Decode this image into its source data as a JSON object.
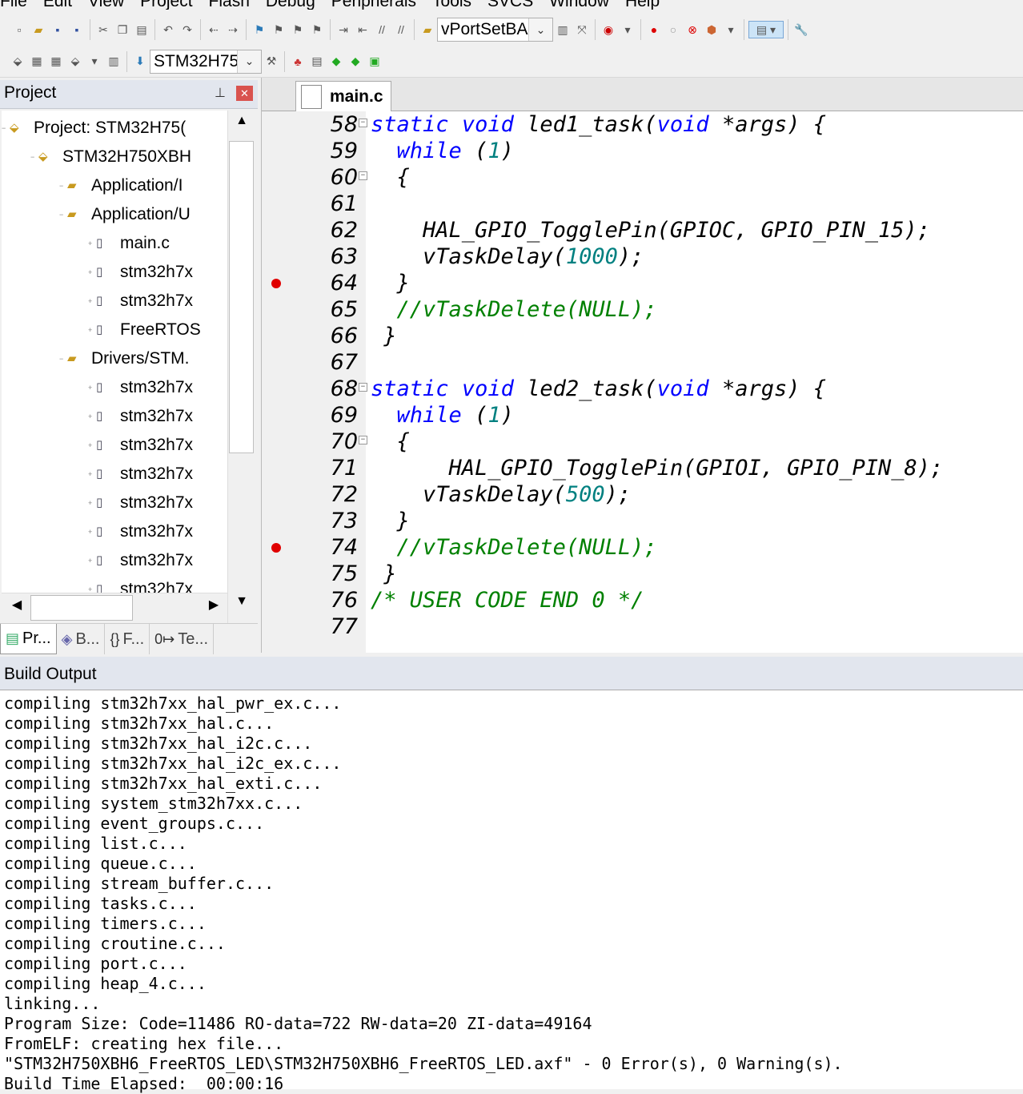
{
  "menu": [
    "File",
    "Edit",
    "View",
    "Project",
    "Flash",
    "Debug",
    "Peripherals",
    "Tools",
    "SVCS",
    "Window",
    "Help"
  ],
  "toolbar": {
    "function_combo": "vPortSetBA",
    "target_combo": "STM32H75"
  },
  "project": {
    "title": "Project",
    "tree": [
      {
        "label": "Project: STM32H75(",
        "kind": "root"
      },
      {
        "label": "STM32H750XBH",
        "kind": "target"
      },
      {
        "label": "Application/I",
        "kind": "folder"
      },
      {
        "label": "Application/U",
        "kind": "folder"
      },
      {
        "label": "main.c",
        "kind": "file"
      },
      {
        "label": "stm32h7x",
        "kind": "file"
      },
      {
        "label": "stm32h7x",
        "kind": "file"
      },
      {
        "label": "FreeRTOS",
        "kind": "file"
      },
      {
        "label": "Drivers/STM.",
        "kind": "folder"
      },
      {
        "label": "stm32h7x",
        "kind": "file"
      },
      {
        "label": "stm32h7x",
        "kind": "file"
      },
      {
        "label": "stm32h7x",
        "kind": "file"
      },
      {
        "label": "stm32h7x",
        "kind": "file"
      },
      {
        "label": "stm32h7x",
        "kind": "file"
      },
      {
        "label": "stm32h7x",
        "kind": "file"
      },
      {
        "label": "stm32h7x",
        "kind": "file"
      },
      {
        "label": "stm32h7x",
        "kind": "file"
      }
    ],
    "tabs": [
      "Pr...",
      "B...",
      "F...",
      "Te..."
    ]
  },
  "editor": {
    "tab": "main.c",
    "lines": [
      {
        "n": "58",
        "t": "static void led1_task(void *args) {",
        "bp": false,
        "fold": true
      },
      {
        "n": "59",
        "t": "  while (1)",
        "bp": false,
        "fold": false
      },
      {
        "n": "60",
        "t": "  {",
        "bp": false,
        "fold": true
      },
      {
        "n": "61",
        "t": "",
        "bp": false,
        "fold": false
      },
      {
        "n": "62",
        "t": "    HAL_GPIO_TogglePin(GPIOC, GPIO_PIN_15);",
        "bp": false,
        "fold": false
      },
      {
        "n": "63",
        "t": "    vTaskDelay(1000);",
        "bp": false,
        "fold": false
      },
      {
        "n": "64",
        "t": "  }",
        "bp": true,
        "fold": false
      },
      {
        "n": "65",
        "t": "  //vTaskDelete(NULL);",
        "bp": false,
        "fold": false
      },
      {
        "n": "66",
        "t": " }",
        "bp": false,
        "fold": false
      },
      {
        "n": "67",
        "t": "",
        "bp": false,
        "fold": false
      },
      {
        "n": "68",
        "t": "static void led2_task(void *args) {",
        "bp": false,
        "fold": true
      },
      {
        "n": "69",
        "t": "  while (1)",
        "bp": false,
        "fold": false
      },
      {
        "n": "70",
        "t": "  {",
        "bp": false,
        "fold": true
      },
      {
        "n": "71",
        "t": "      HAL_GPIO_TogglePin(GPIOI, GPIO_PIN_8);",
        "bp": false,
        "fold": false
      },
      {
        "n": "72",
        "t": "    vTaskDelay(500);",
        "bp": false,
        "fold": false
      },
      {
        "n": "73",
        "t": "  }",
        "bp": false,
        "fold": false
      },
      {
        "n": "74",
        "t": "  //vTaskDelete(NULL);",
        "bp": true,
        "fold": false
      },
      {
        "n": "75",
        "t": " }",
        "bp": false,
        "fold": false
      },
      {
        "n": "76",
        "t": "/* USER CODE END 0 */",
        "bp": false,
        "fold": false
      },
      {
        "n": "77",
        "t": "",
        "bp": false,
        "fold": false
      }
    ]
  },
  "build_output": {
    "title": "Build Output",
    "lines": [
      "compiling stm32h7xx_hal_pwr_ex.c...",
      "compiling stm32h7xx_hal.c...",
      "compiling stm32h7xx_hal_i2c.c...",
      "compiling stm32h7xx_hal_i2c_ex.c...",
      "compiling stm32h7xx_hal_exti.c...",
      "compiling system_stm32h7xx.c...",
      "compiling event_groups.c...",
      "compiling list.c...",
      "compiling queue.c...",
      "compiling stream_buffer.c...",
      "compiling tasks.c...",
      "compiling timers.c...",
      "compiling croutine.c...",
      "compiling port.c...",
      "compiling heap_4.c...",
      "linking...",
      "Program Size: Code=11486 RO-data=722 RW-data=20 ZI-data=49164",
      "FromELF: creating hex file...",
      "\"STM32H750XBH6_FreeRTOS_LED\\STM32H750XBH6_FreeRTOS_LED.axf\" - 0 Error(s), 0 Warning(s).",
      "Build Time Elapsed:  00:00:16"
    ]
  }
}
